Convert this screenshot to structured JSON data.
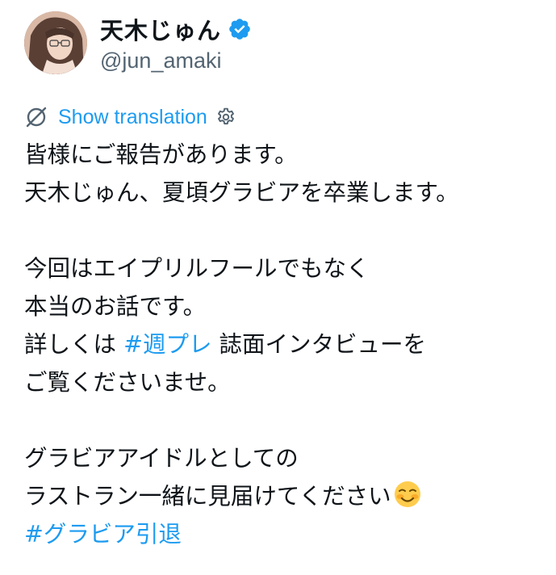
{
  "user": {
    "display_name": "天木じゅん",
    "handle": "@jun_amaki",
    "verified_color": "#1d9bf0"
  },
  "translation": {
    "label": "Show translation"
  },
  "tweet": {
    "line1": "皆様にご報告があります。",
    "line2": "天木じゅん、夏頃グラビアを卒業します。",
    "line3": "今回はエイプリルフールでもなく",
    "line4": "本当のお話です。",
    "line5_pre": "詳しくは ",
    "line5_hashtag": "#週プレ",
    "line5_post": " 誌面インタビューを",
    "line6": "ご覧くださいませ。",
    "line7": "グラビアアイドルとしての",
    "line8": "ラストラン一緒に見届けてください",
    "line8_emoji": "smiling-face-with-blush-emoji",
    "hashtag_final": "#グラビア引退"
  },
  "colors": {
    "link": "#1d9bf0",
    "text": "#0f1419",
    "secondary": "#536471"
  }
}
